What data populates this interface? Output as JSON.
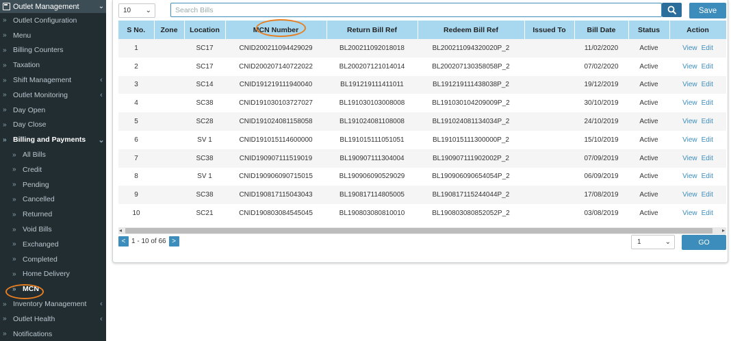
{
  "sidebar": {
    "header": "Outlet Management",
    "items": [
      {
        "label": "Outlet Configuration",
        "arrow": "",
        "type": "top"
      },
      {
        "label": "Menu",
        "arrow": "",
        "type": "top"
      },
      {
        "label": "Billing Counters",
        "arrow": "",
        "type": "top"
      },
      {
        "label": "Taxation",
        "arrow": "",
        "type": "top"
      },
      {
        "label": "Shift Management",
        "arrow": "‹",
        "type": "top"
      },
      {
        "label": "Outlet Monitoring",
        "arrow": "‹",
        "type": "top"
      },
      {
        "label": "Day Open",
        "arrow": "",
        "type": "top"
      },
      {
        "label": "Day Close",
        "arrow": "",
        "type": "top"
      },
      {
        "label": "Billing and Payments",
        "arrow": "⌄",
        "type": "bold"
      },
      {
        "label": "All Bills",
        "arrow": "",
        "type": "sub"
      },
      {
        "label": "Credit",
        "arrow": "",
        "type": "sub"
      },
      {
        "label": "Pending",
        "arrow": "",
        "type": "sub"
      },
      {
        "label": "Cancelled",
        "arrow": "",
        "type": "sub"
      },
      {
        "label": "Returned",
        "arrow": "",
        "type": "sub"
      },
      {
        "label": "Void Bills",
        "arrow": "",
        "type": "sub"
      },
      {
        "label": "Exchanged",
        "arrow": "",
        "type": "sub"
      },
      {
        "label": "Completed",
        "arrow": "",
        "type": "sub"
      },
      {
        "label": "Home Delivery",
        "arrow": "",
        "type": "sub"
      },
      {
        "label": "MCN",
        "arrow": "",
        "type": "active"
      },
      {
        "label": "Inventory Management",
        "arrow": "‹",
        "type": "top"
      },
      {
        "label": "Outlet Health",
        "arrow": "‹",
        "type": "top"
      },
      {
        "label": "Notifications",
        "arrow": "",
        "type": "top"
      }
    ]
  },
  "toolbar": {
    "page_size": "10",
    "search_placeholder": "Search Bills",
    "save_label": "Save"
  },
  "table": {
    "columns": [
      "S No.",
      "Zone",
      "Location",
      "MCN Number",
      "Return Bill Ref",
      "Redeem Bill Ref",
      "Issued To",
      "Bill Date",
      "Status",
      "Action"
    ],
    "rows": [
      [
        "1",
        "",
        "SC17",
        "CNID200211094429029",
        "BL200211092018018",
        "BL200211094320020P_2",
        "",
        "11/02/2020",
        "Active"
      ],
      [
        "2",
        "",
        "SC17",
        "CNID200207140722022",
        "BL200207121014014",
        "BL200207130358058P_2",
        "",
        "07/02/2020",
        "Active"
      ],
      [
        "3",
        "",
        "SC14",
        "CNID191219111940040",
        "BL191219111411011",
        "BL191219111438038P_2",
        "",
        "19/12/2019",
        "Active"
      ],
      [
        "4",
        "",
        "SC38",
        "CNID191030103727027",
        "BL191030103008008",
        "BL191030104209009P_2",
        "",
        "30/10/2019",
        "Active"
      ],
      [
        "5",
        "",
        "SC28",
        "CNID191024081158058",
        "BL191024081108008",
        "BL191024081134034P_2",
        "",
        "24/10/2019",
        "Active"
      ],
      [
        "6",
        "",
        "SV 1",
        "CNID191015114600000",
        "BL191015111051051",
        "BL191015111300000P_2",
        "",
        "15/10/2019",
        "Active"
      ],
      [
        "7",
        "",
        "SC38",
        "CNID190907111519019",
        "BL190907111304004",
        "BL190907111902002P_2",
        "",
        "07/09/2019",
        "Active"
      ],
      [
        "8",
        "",
        "SV 1",
        "CNID190906090715015",
        "BL190906090529029",
        "BL190906090654054P_2",
        "",
        "06/09/2019",
        "Active"
      ],
      [
        "9",
        "",
        "SC38",
        "CNID190817115043043",
        "BL190817114805005",
        "BL190817115244044P_2",
        "",
        "17/08/2019",
        "Active"
      ],
      [
        "10",
        "",
        "SC21",
        "CNID190803084545045",
        "BL190803080810010",
        "BL190803080852052P_2",
        "",
        "03/08/2019",
        "Active"
      ]
    ],
    "action_view": "View",
    "action_edit": "Edit"
  },
  "pager": {
    "prev": "<",
    "next": ">",
    "range_text": "1 - 10 of 66",
    "goto_page": "1",
    "go_label": "GO"
  },
  "colors": {
    "sidebar_bg": "#222d32",
    "header_bg": "#a7d8f0",
    "accent": "#3c8dbc",
    "highlight_ring": "#e67e22"
  }
}
